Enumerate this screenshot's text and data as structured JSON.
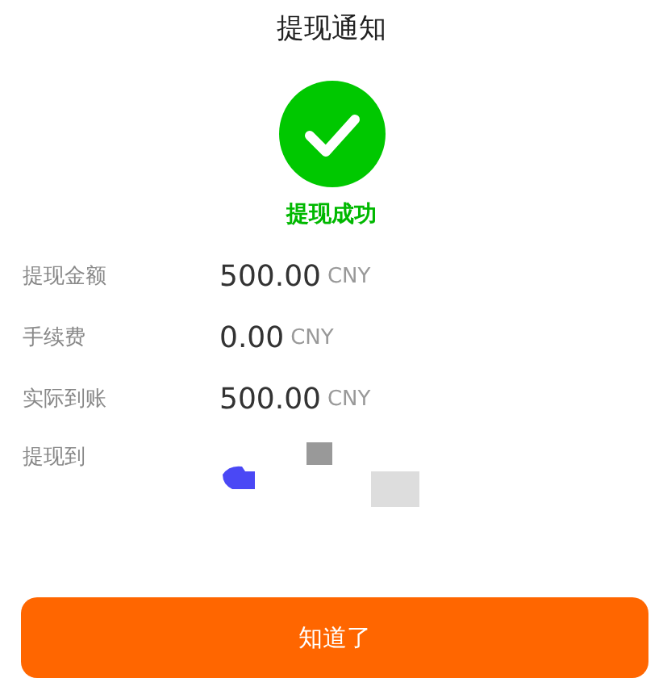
{
  "header": {
    "title": "提现通知"
  },
  "status": {
    "kind": "success",
    "text": "提现成功"
  },
  "details": [
    {
      "label": "提现金额",
      "amount": "500.00",
      "unit": "CNY"
    },
    {
      "label": "手续费",
      "amount": "0.00",
      "unit": "CNY"
    },
    {
      "label": "实际到账",
      "amount": "500.00",
      "unit": "CNY"
    }
  ],
  "destination": {
    "label": "提现到"
  },
  "button": {
    "label": "知道了"
  }
}
